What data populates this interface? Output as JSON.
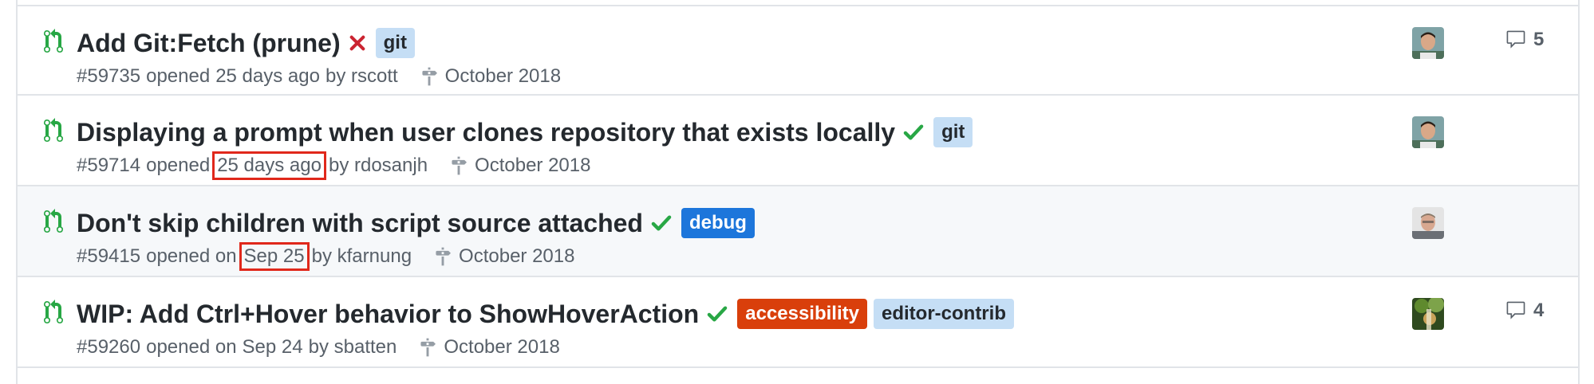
{
  "colors": {
    "border": "#e1e4e8",
    "pr_open": "#28a745",
    "fail": "#cb2431",
    "success": "#28a745",
    "highlight_box": "#e0281b"
  },
  "rows": [
    {
      "title": "Add Git:Fetch (prune)",
      "status": "failure",
      "labels": [
        {
          "name": "git",
          "bg": "#c5def5",
          "fg": "#24292e"
        }
      ],
      "number": "#59735",
      "opened": "opened",
      "when": "25 days ago",
      "by": "by rscott",
      "milestone": "October 2018",
      "avatar": "avatar-1",
      "comments": "5"
    },
    {
      "title": "Displaying a prompt when user clones repository that exists locally",
      "status": "success",
      "labels": [
        {
          "name": "git",
          "bg": "#c5def5",
          "fg": "#24292e"
        }
      ],
      "number": "#59714",
      "opened": "opened",
      "when": "25 days ago",
      "by": "by rdosanjh",
      "milestone": "October 2018",
      "avatar": "avatar-1",
      "comments": ""
    },
    {
      "title": "Don't skip children with script source attached",
      "status": "success",
      "labels": [
        {
          "name": "debug",
          "bg": "#1d76db",
          "fg": "#ffffff"
        }
      ],
      "number": "#59415",
      "opened": "opened on",
      "when": "Sep 25",
      "by": "by kfarnung",
      "milestone": "October 2018",
      "avatar": "avatar-2",
      "comments": ""
    },
    {
      "title": "WIP: Add Ctrl+Hover behavior to ShowHoverAction",
      "status": "success",
      "labels": [
        {
          "name": "accessibility",
          "bg": "#d93f0b",
          "fg": "#ffffff"
        },
        {
          "name": "editor-contrib",
          "bg": "#c5def5",
          "fg": "#24292e"
        }
      ],
      "number": "#59260",
      "opened": "opened on",
      "when": "Sep 24",
      "by": "by sbatten",
      "milestone": "October 2018",
      "avatar": "avatar-3",
      "comments": "4"
    }
  ]
}
